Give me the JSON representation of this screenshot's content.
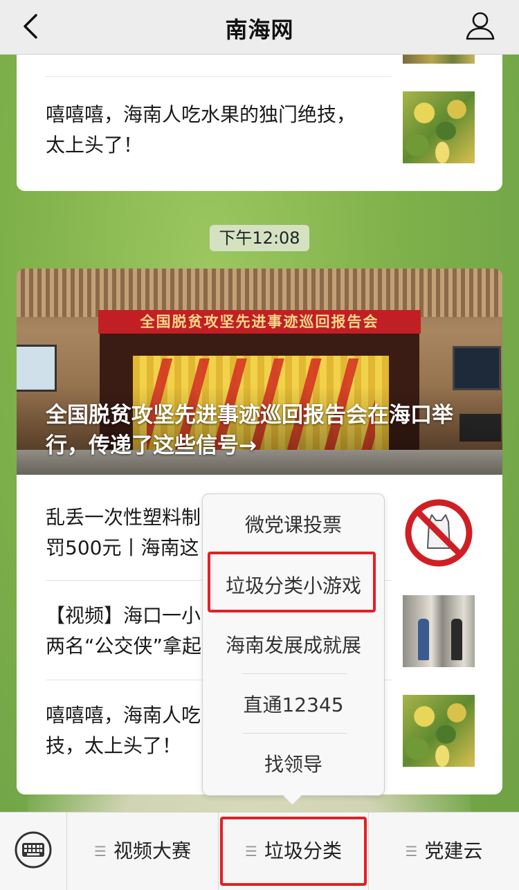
{
  "header": {
    "title": "南海网"
  },
  "feed": {
    "card1": {
      "item_text": "嘻嘻嘻，海南人吃水果的独门绝技，太上头了！"
    },
    "time": "下午12:08",
    "card2": {
      "hero_title": "全国脱贫攻坚先进事迹巡回报告会在海口举行，传递了这些信号→",
      "hero_banner": "全国脱贫攻坚先进事迹巡回报告会",
      "items": [
        {
          "line1": "乱丢一次性塑料制",
          "line2": "罚500元丨海南这",
          "thumb": "no-plastic-bag"
        },
        {
          "line1": "【视频】海口一小",
          "line2": "两名“公交侠”拿起",
          "thumb": "people-photo"
        },
        {
          "line1": "嘻嘻嘻，海南人吃",
          "line2": "技，太上头了！",
          "thumb": "fruit-photo"
        }
      ]
    }
  },
  "popup_menu": {
    "items": [
      "微党课投票",
      "垃圾分类小游戏",
      "海南发展成就展",
      "直通12345",
      "找领导"
    ],
    "highlighted": "垃圾分类小游戏"
  },
  "tabbar": {
    "tabs": [
      "视频大赛",
      "垃圾分类",
      "党建云"
    ],
    "highlighted": "垃圾分类"
  },
  "colors": {
    "highlight": "#e41f26",
    "background": "#7fb04a",
    "header_bg": "#ededed"
  }
}
